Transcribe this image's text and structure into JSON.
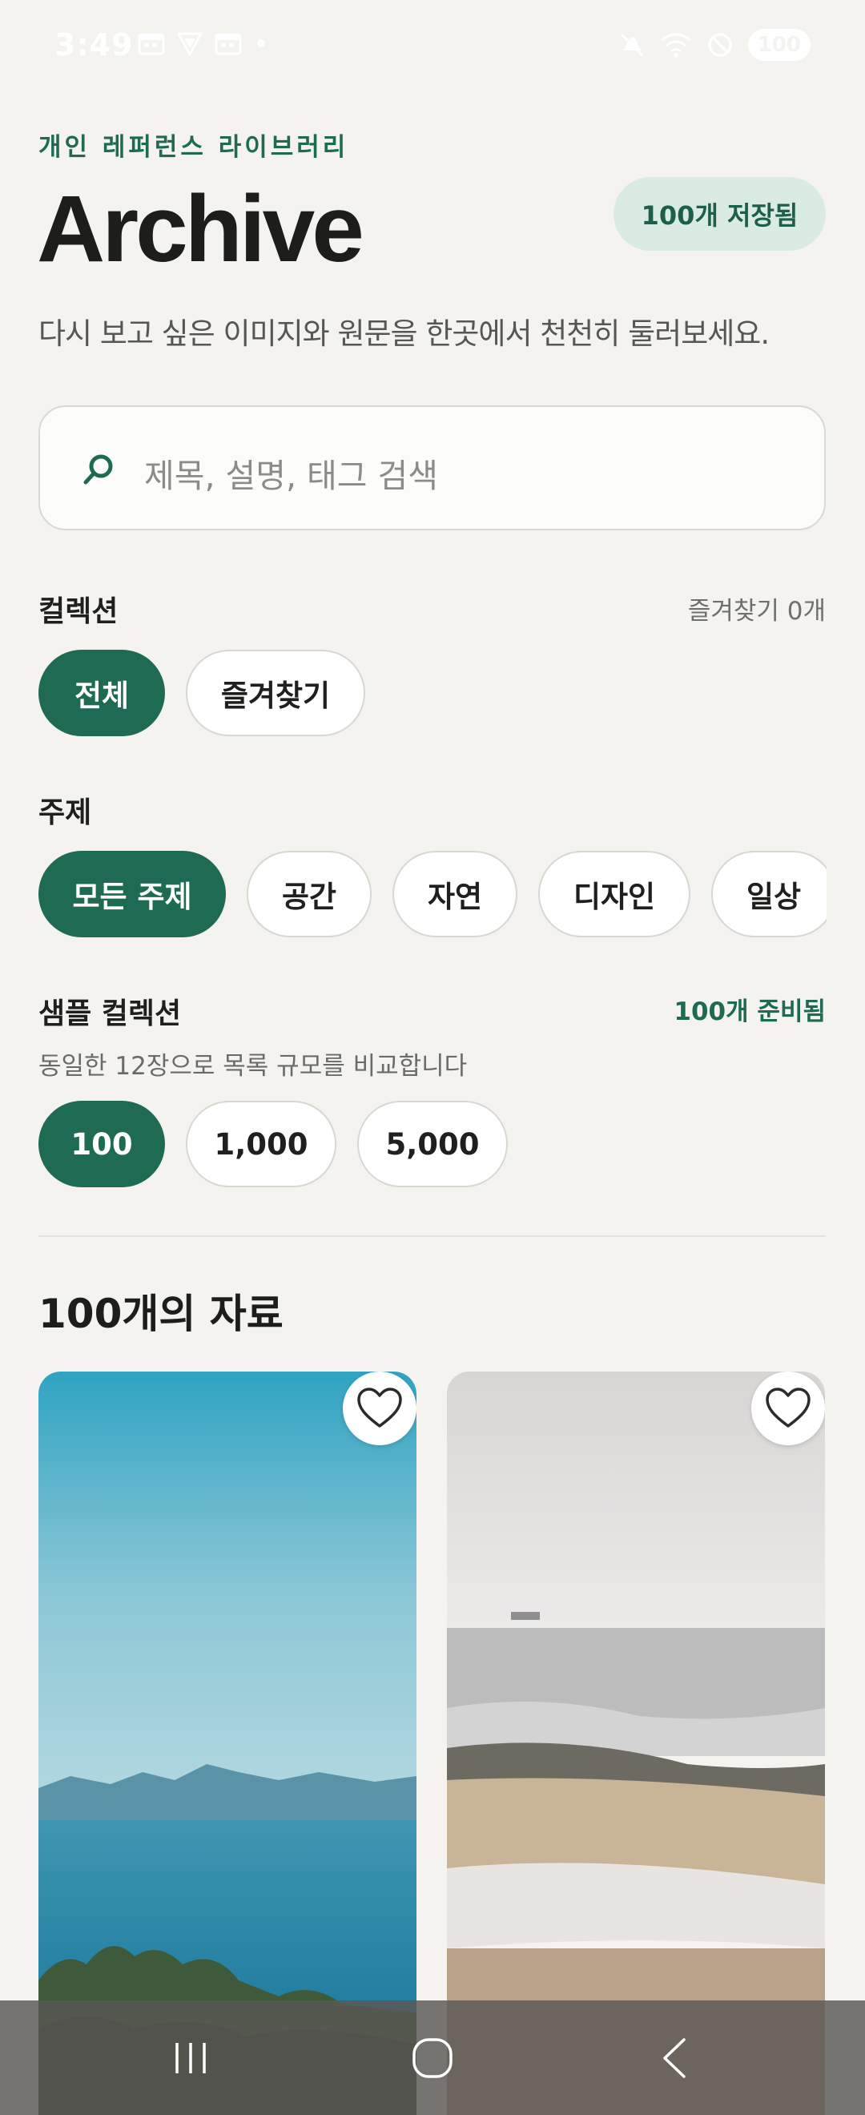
{
  "status_bar": {
    "time": "3:49",
    "battery": "100",
    "left_icons": [
      "calendar-icon",
      "shield-icon",
      "calendar-icon",
      "dot-icon"
    ],
    "right_icons": [
      "mute-icon",
      "wifi-icon",
      "do-not-disturb-icon",
      "battery-icon"
    ]
  },
  "header": {
    "eyebrow": "개인 레퍼런스 라이브러리",
    "title": "Archive",
    "saved_badge": "100개 저장됨",
    "subtitle": "다시 보고 싶은 이미지와 원문을 한곳에서 천천히 둘러보세요."
  },
  "search": {
    "placeholder": "제목, 설명, 태그 검색",
    "icon": "search-icon"
  },
  "collection": {
    "label": "컬렉션",
    "meta": "즐겨찾기 0개",
    "chips": [
      {
        "label": "전체",
        "active": true
      },
      {
        "label": "즐겨찾기",
        "active": false
      }
    ]
  },
  "topic": {
    "label": "주제",
    "chips": [
      {
        "label": "모든 주제",
        "active": true
      },
      {
        "label": "공간",
        "active": false
      },
      {
        "label": "자연",
        "active": false
      },
      {
        "label": "디자인",
        "active": false
      },
      {
        "label": "일상",
        "active": false
      }
    ]
  },
  "sample": {
    "label": "샘플 컬렉션",
    "meta": "100개 준비됨",
    "description": "동일한 12장으로 목록 규모를 비교합니다",
    "chips": [
      {
        "label": "100",
        "active": true
      },
      {
        "label": "1,000",
        "active": false
      },
      {
        "label": "5,000",
        "active": false
      }
    ]
  },
  "list": {
    "heading": "100개의 자료",
    "cards": [
      {
        "image": "blue sea with mountains",
        "favorite_icon": "heart-outline-icon"
      },
      {
        "image": "grey beach shoreline",
        "favorite_icon": "heart-outline-icon"
      }
    ]
  },
  "nav": {
    "items": [
      "recent-apps-icon",
      "home-icon",
      "back-icon"
    ]
  },
  "colors": {
    "accent": "#1e6a52",
    "badge_bg": "#d9ebe2",
    "background": "#f4f3f0"
  }
}
